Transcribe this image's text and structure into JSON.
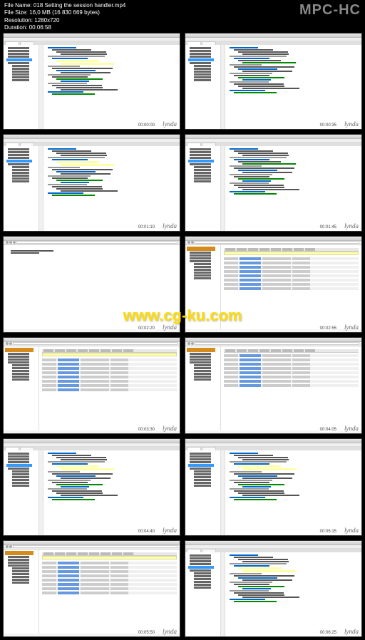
{
  "header": {
    "file_name_label": "File Name:",
    "file_name": "018 Setting the session handler.mp4",
    "file_size_label": "File Size:",
    "file_size": "16,0 MB (16 830 669 bytes)",
    "resolution_label": "Resolution:",
    "resolution": "1280x720",
    "duration_label": "Duration:",
    "duration": "00:06:58",
    "player_brand": "MPC-HC"
  },
  "watermarks": {
    "lynda": "lynda",
    "cgku": "www.cg-ku.com"
  },
  "thumbnails": [
    {
      "type": "ide",
      "highlighted_line": true,
      "timecode": "00:00:00"
    },
    {
      "type": "ide",
      "highlighted_line": false,
      "timecode": "00:00:35"
    },
    {
      "type": "ide",
      "highlighted_line": true,
      "timecode": "00:01:10"
    },
    {
      "type": "ide",
      "highlighted_line": false,
      "timecode": "00:01:45"
    },
    {
      "type": "browser",
      "content": "text",
      "timecode": "00:02:20"
    },
    {
      "type": "pma",
      "banner": true,
      "timecode": "00:02:55"
    },
    {
      "type": "pma",
      "banner": true,
      "timecode": "00:03:30"
    },
    {
      "type": "pma",
      "banner": false,
      "timecode": "00:04:05"
    },
    {
      "type": "ide",
      "highlighted_line": true,
      "timecode": "00:04:40"
    },
    {
      "type": "ide",
      "highlighted_line": true,
      "timecode": "00:05:15"
    },
    {
      "type": "pma",
      "banner": true,
      "timecode": "00:05:50"
    },
    {
      "type": "ide",
      "highlighted_line": true,
      "timecode": "00:06:25"
    }
  ]
}
